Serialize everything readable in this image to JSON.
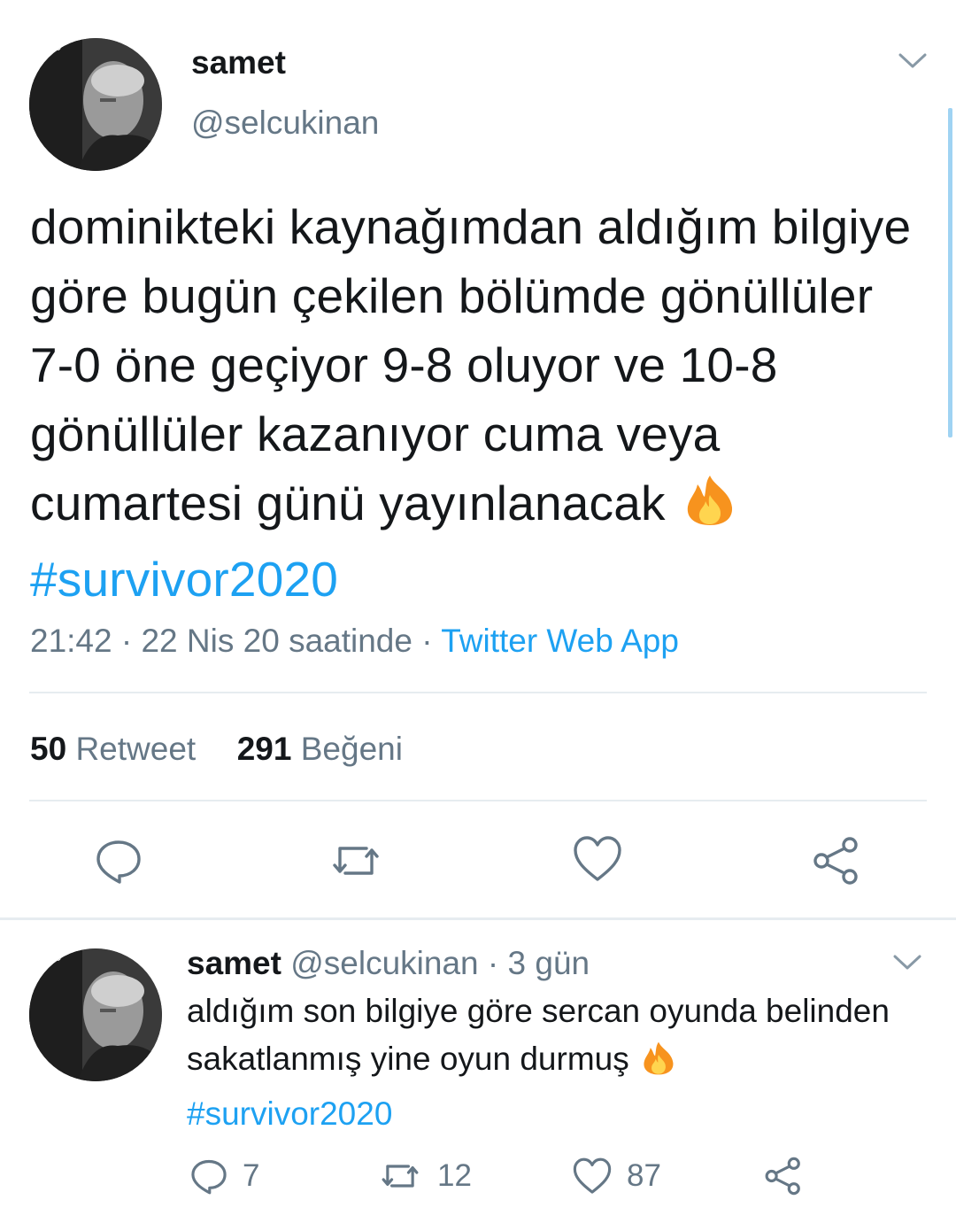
{
  "main_tweet": {
    "author_name": "samet",
    "author_handle": "@selcukinan",
    "text": "dominikteki kaynağımdan aldığım bilgiye göre bugün çekilen bölümde gönüllüler 7-0 öne geçiyor 9-8 oluyor ve 10-8 gönüllüler kazanıyor cuma veya cumartesi günü yayınlanacak",
    "emoji": "fire",
    "hashtag": "#survivor2020",
    "time": "21:42",
    "date": "22 Nis 20 saatinde",
    "source": "Twitter Web App",
    "retweet_count": "50",
    "retweet_label": "Retweet",
    "like_count": "291",
    "like_label": "Beğeni",
    "actions": [
      "reply-icon",
      "retweet-icon",
      "like-icon",
      "share-icon"
    ]
  },
  "reply_tweet": {
    "author_name": "samet",
    "author_handle": "@selcukinan",
    "time_ago": "· 3 gün",
    "text": "aldığım son bilgiye göre sercan oyunda belinden sakatlanmış yine oyun durmuş",
    "emoji": "fire",
    "hashtag": "#survivor2020",
    "reply_count": "7",
    "retweet_count": "12",
    "like_count": "87"
  },
  "colors": {
    "link": "#1da1f2",
    "secondary": "#657786",
    "divider": "#e6ecf0"
  }
}
